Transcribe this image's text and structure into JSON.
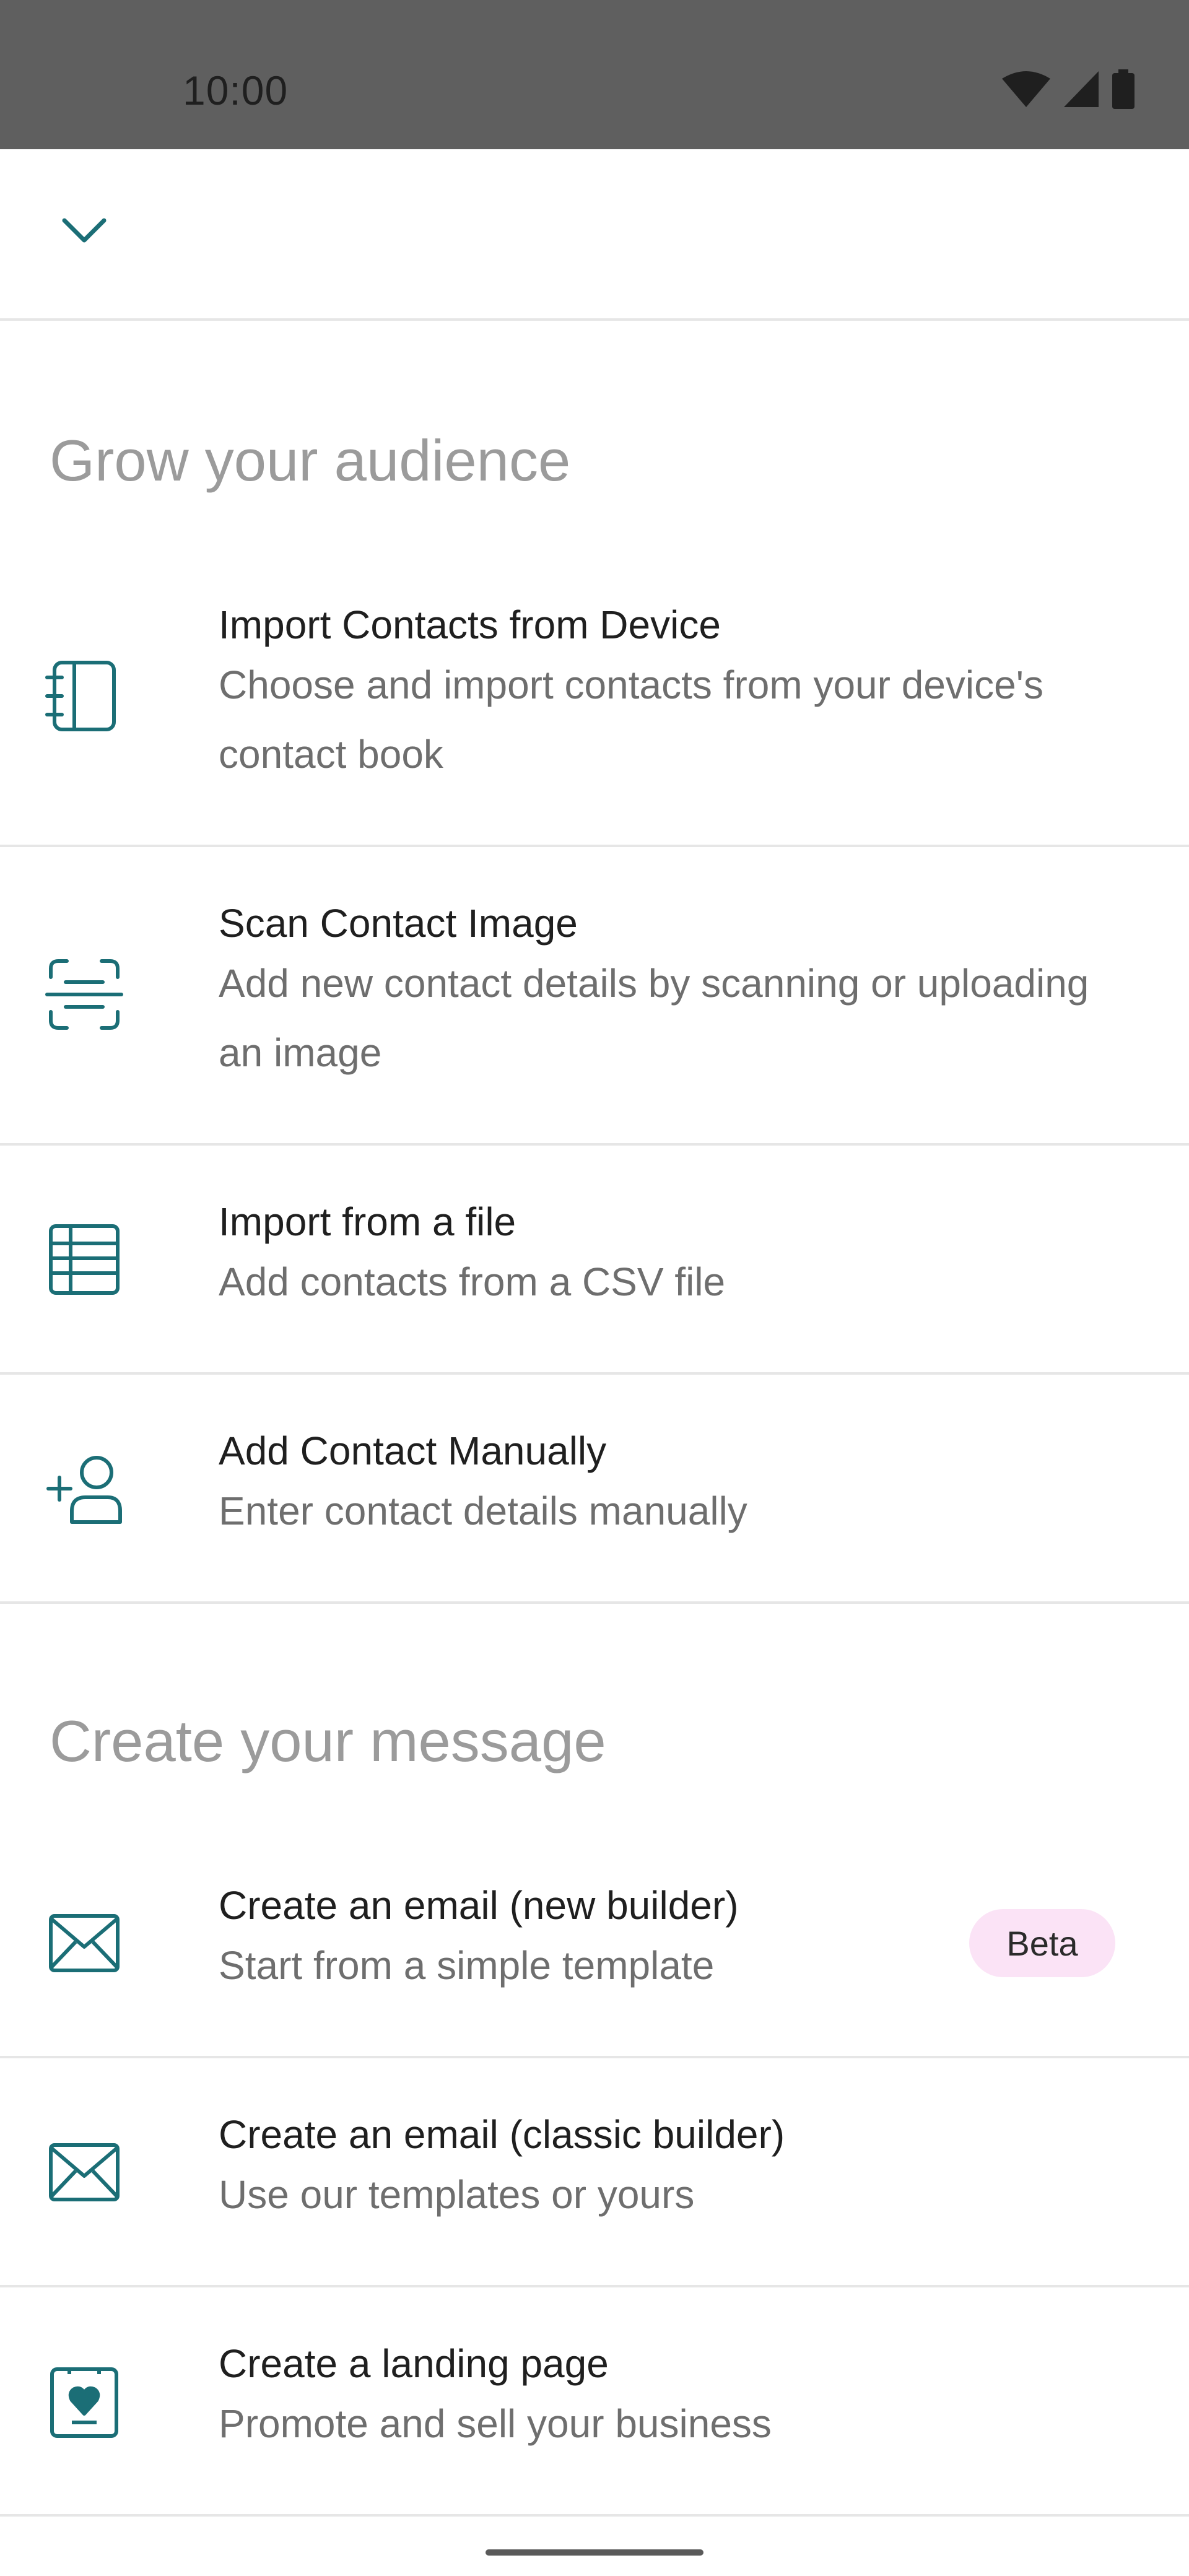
{
  "status": {
    "time": "10:00"
  },
  "sections": {
    "grow": {
      "title": "Grow your audience",
      "items": [
        {
          "title": "Import Contacts from Device",
          "description": "Choose and import contacts from your device's contact book",
          "icon": "contact-book-icon"
        },
        {
          "title": "Scan Contact Image",
          "description": "Add new contact details by scanning or uploading an image",
          "icon": "scan-icon"
        },
        {
          "title": "Import from a file",
          "description": "Add contacts from a CSV file",
          "icon": "table-file-icon"
        },
        {
          "title": "Add Contact Manually",
          "description": "Enter contact details manually",
          "icon": "add-person-icon"
        }
      ]
    },
    "create": {
      "title": "Create your message",
      "items": [
        {
          "title": "Create an email (new builder)",
          "description": "Start from a simple template",
          "badge": "Beta",
          "icon": "envelope-icon"
        },
        {
          "title": "Create an email (classic builder)",
          "description": "Use our templates or yours",
          "icon": "envelope-icon"
        },
        {
          "title": "Create a landing page",
          "description": "Promote and sell your business",
          "icon": "landing-page-heart-icon"
        }
      ]
    }
  },
  "colors": {
    "accent": "#1b6e76",
    "badge_bg": "#fbe3f6",
    "section_title": "#9b9b9b"
  }
}
